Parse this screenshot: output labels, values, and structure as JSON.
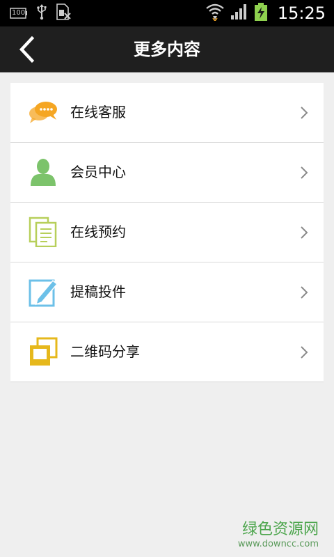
{
  "status_bar": {
    "battery_level_label": "100",
    "time": "15:25",
    "icons": [
      "battery-level-icon",
      "usb-icon",
      "sim-icon",
      "wifi-icon",
      "signal-icon",
      "battery-charging-icon"
    ]
  },
  "title_bar": {
    "title": "更多内容",
    "back_icon": "back-arrow-icon"
  },
  "menu": {
    "items": [
      {
        "label": "在线客服",
        "icon": "chat-bubble-icon",
        "icon_color": "#f5a623"
      },
      {
        "label": "会员中心",
        "icon": "user-icon",
        "icon_color": "#7cc36b"
      },
      {
        "label": "在线预约",
        "icon": "document-copy-icon",
        "icon_color": "#b7cf5a"
      },
      {
        "label": "提稿投件",
        "icon": "edit-icon",
        "icon_color": "#6cc0e8"
      },
      {
        "label": "二维码分享",
        "icon": "photo-stack-icon",
        "icon_color": "#e6b81c"
      }
    ]
  },
  "watermark": {
    "title": "绿色资源网",
    "url": "www.downcc.com"
  },
  "colors": {
    "status_bar_bg": "#000000",
    "title_bar_bg": "#1f1f1f",
    "page_bg": "#efefef",
    "card_bg": "#ffffff",
    "watermark_green": "#4ca54c"
  }
}
